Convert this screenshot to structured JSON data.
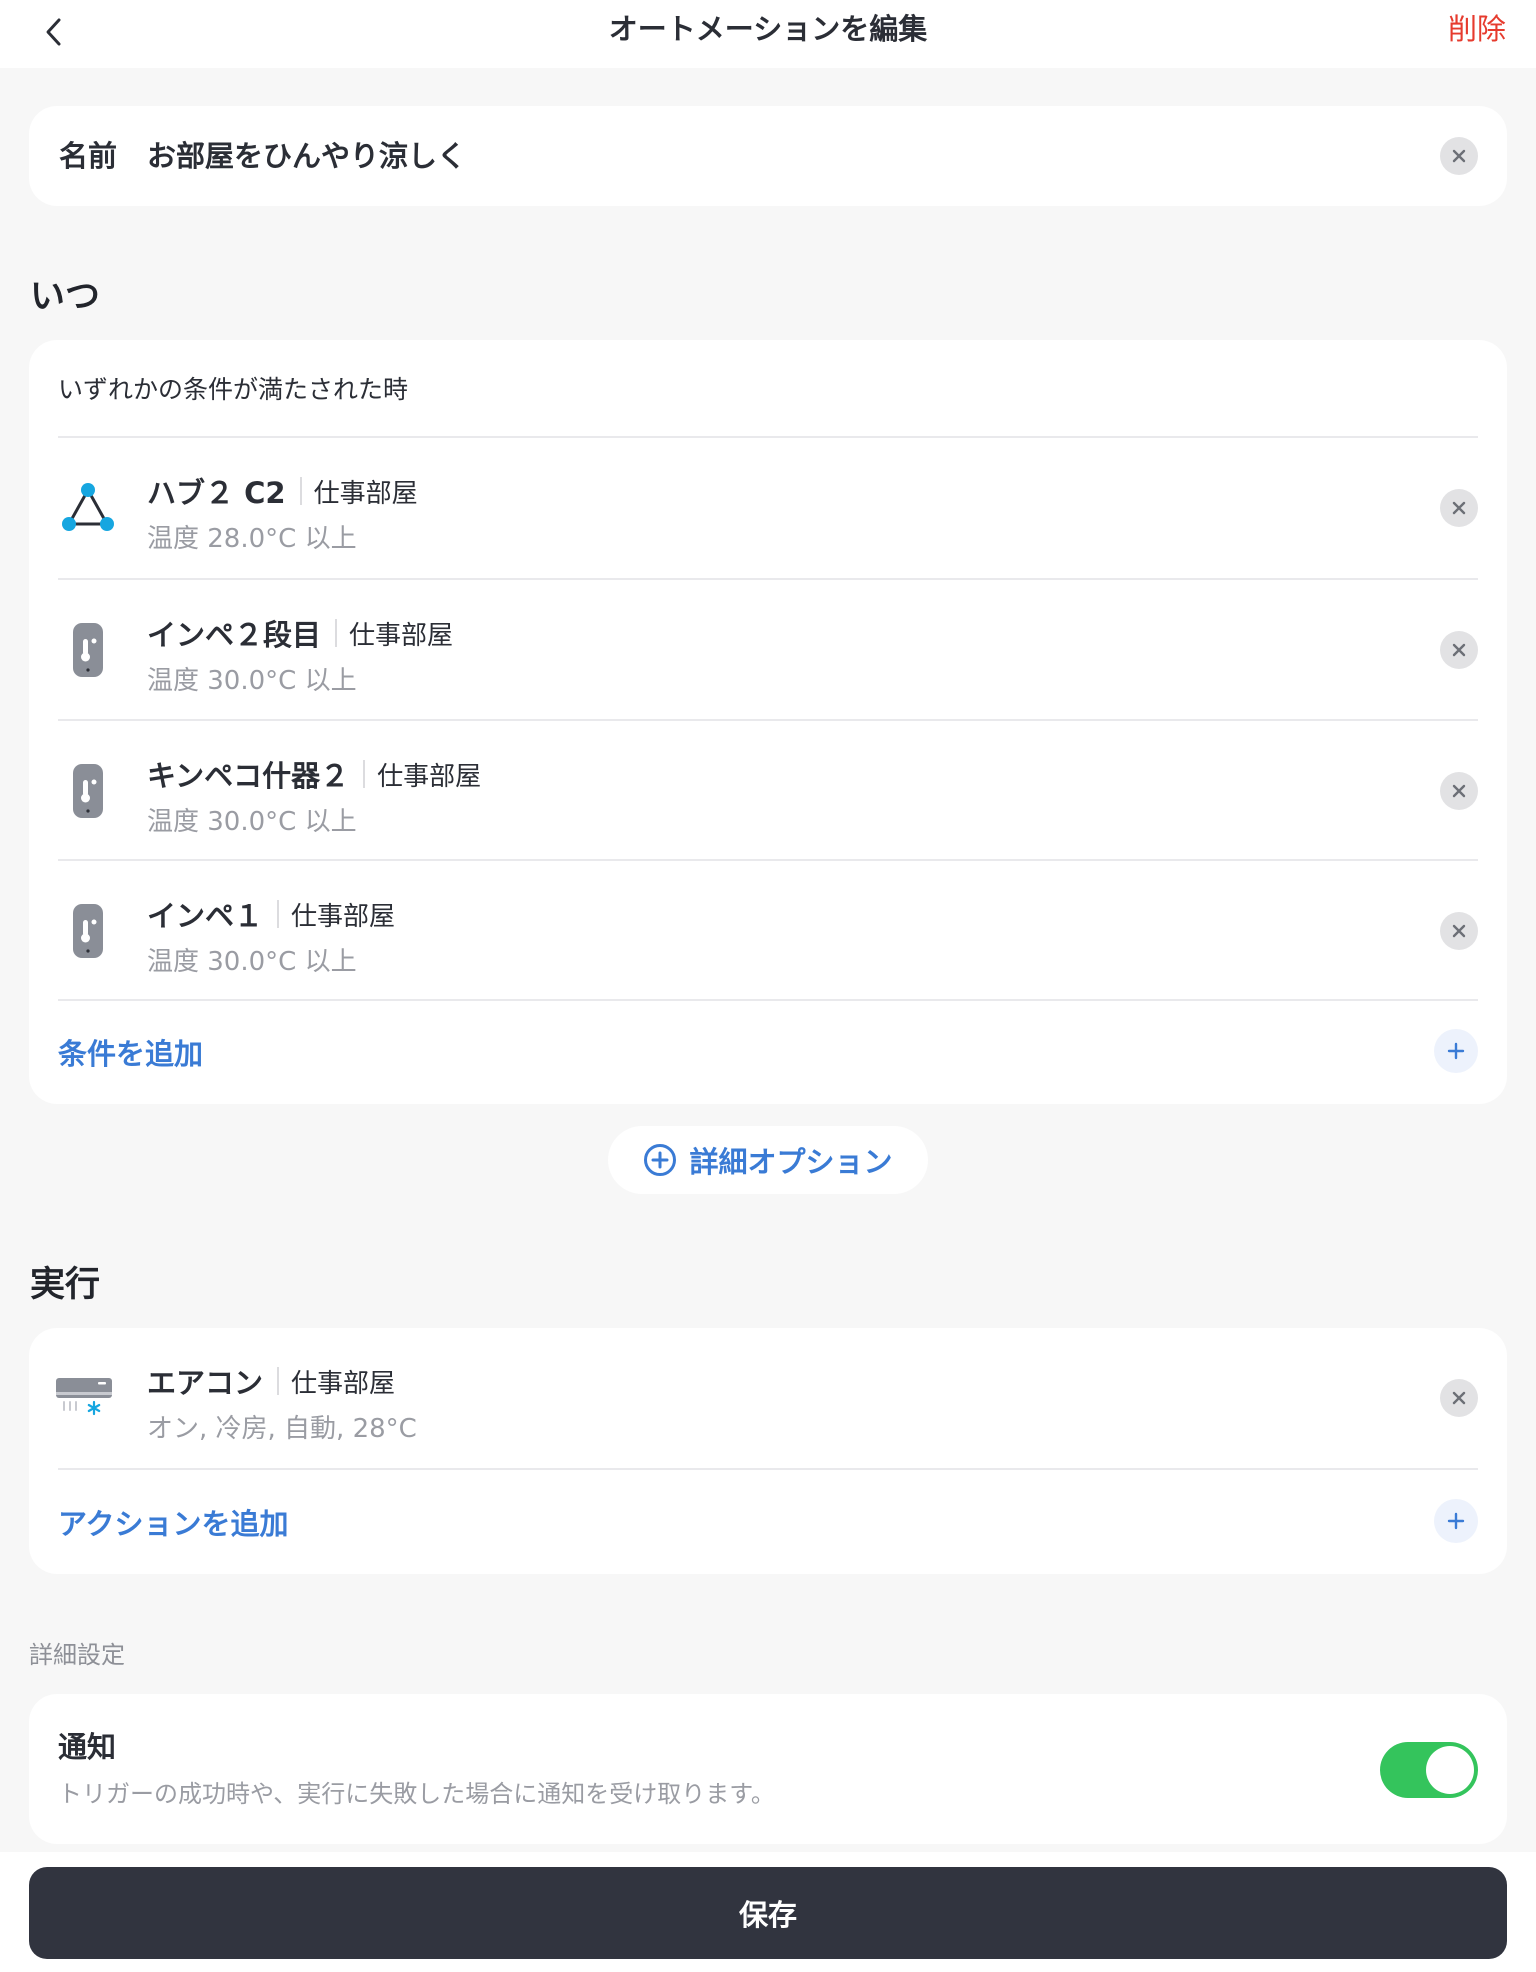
{
  "header": {
    "title": "オートメーションを編集",
    "delete_label": "削除"
  },
  "name_field": {
    "label": "名前",
    "value": "お部屋をひんやり涼しく"
  },
  "when_section": {
    "title": "いつ",
    "subtitle": "いずれかの条件が満たされた時",
    "conditions": [
      {
        "device": "ハブ２ C2",
        "room": "仕事部屋",
        "detail": "温度 28.0°C 以上",
        "icon": "hub-icon"
      },
      {
        "device": "インペ２段目",
        "room": "仕事部屋",
        "detail": "温度 30.0°C 以上",
        "icon": "thermometer-sensor-icon"
      },
      {
        "device": "キンペコ什器２",
        "room": "仕事部屋",
        "detail": "温度 30.0°C 以上",
        "icon": "thermometer-sensor-icon"
      },
      {
        "device": "インペ１",
        "room": "仕事部屋",
        "detail": "温度 30.0°C 以上",
        "icon": "thermometer-sensor-icon"
      }
    ],
    "add_label": "条件を追加"
  },
  "advanced_option_label": "詳細オプション",
  "action_section": {
    "title": "実行",
    "actions": [
      {
        "device": "エアコン",
        "room": "仕事部屋",
        "detail": "オン, 冷房, 自動, 28°C",
        "icon": "air-conditioner-icon"
      }
    ],
    "add_label": "アクションを追加"
  },
  "settings": {
    "section_label": "詳細設定",
    "notification": {
      "title": "通知",
      "description": "トリガーの成功時や、実行に失敗した場合に通知を受け取ります。",
      "enabled": true
    }
  },
  "save_label": "保存",
  "colors": {
    "accent_blue": "#3a7bd5",
    "delete_red": "#e63b2e",
    "toggle_green": "#34c45c",
    "save_button": "#31343f",
    "hub_cyan": "#16a6e0",
    "sensor_gray": "#8a8e97"
  }
}
